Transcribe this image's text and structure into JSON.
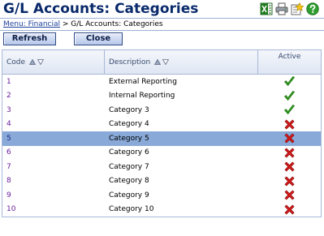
{
  "header": {
    "title": "G/L Accounts: Categories",
    "icons": [
      "excel-export-icon",
      "print-icon",
      "favorites-icon",
      "help-icon"
    ]
  },
  "breadcrumb": {
    "link_label": "Menu: Financial",
    "separator": " > ",
    "current": "G/L Accounts: Categories"
  },
  "buttons": {
    "refresh_label": "Refresh",
    "close_label": "Close"
  },
  "grid": {
    "columns": {
      "code": "Code",
      "description": "Description",
      "active": "Active"
    },
    "selected_row_index": 4,
    "rows": [
      {
        "code": "1",
        "description": "External Reporting",
        "active": true
      },
      {
        "code": "2",
        "description": "Internal Reporting",
        "active": true
      },
      {
        "code": "3",
        "description": "Category 3",
        "active": true
      },
      {
        "code": "4",
        "description": "Category 4",
        "active": false
      },
      {
        "code": "5",
        "description": "Category 5",
        "active": false
      },
      {
        "code": "6",
        "description": "Category 6",
        "active": false
      },
      {
        "code": "7",
        "description": "Category 7",
        "active": false
      },
      {
        "code": "8",
        "description": "Category 8",
        "active": false
      },
      {
        "code": "9",
        "description": "Category 9",
        "active": false
      },
      {
        "code": "10",
        "description": "Category 10",
        "active": false
      }
    ]
  },
  "colors": {
    "title": "#0a2a6b",
    "selected_row": "#89a9d8",
    "code_link": "#6a1f9f",
    "check_green": "#2f9a1c",
    "cross_red": "#d01a1a"
  }
}
